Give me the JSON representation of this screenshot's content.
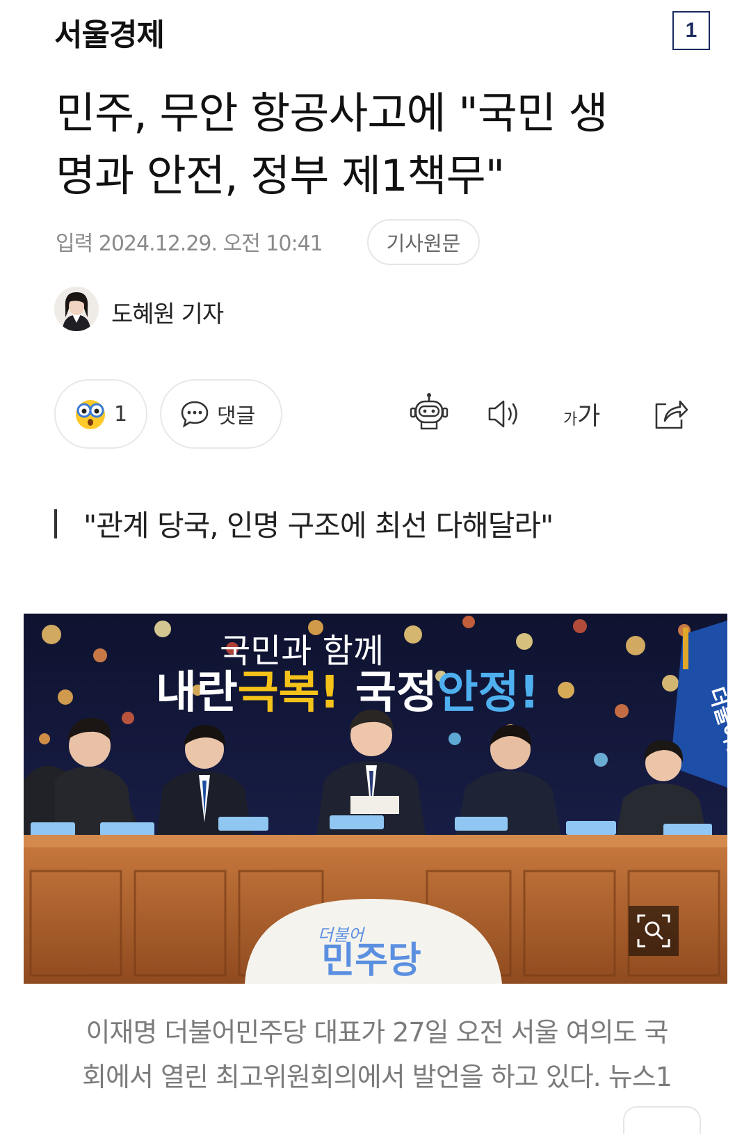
{
  "header": {
    "publisher": "서울경제",
    "page_badge": "1"
  },
  "article": {
    "headline_line1": "민주, 무안 항공사고에 \"국민 생",
    "headline_line2": "명과 안전, 정부 제1책무\"",
    "published": "입력 2024.12.29. 오전 10:41",
    "original_button": "기사원문",
    "reporter": "도혜원 기자",
    "reaction_count": "1",
    "comment_label": "댓글",
    "font_size_label_small": "가",
    "font_size_label_large": "가",
    "subheading": "\"관계 당국, 인명 구조에 최선 다해달라\""
  },
  "photo": {
    "banner_line1": "국민과 함께",
    "banner_part1": "내란",
    "banner_part2": "극복!",
    "banner_part3": "국정",
    "banner_part4": "안정!",
    "flag_text": "더불어민주당",
    "podium_small": "더불어",
    "podium_large": "민주당"
  },
  "caption": {
    "line1": "이재명 더불어민주당 대표가 27일 오전 서울 여의도 국",
    "line2": "회에서 열린 최고위원회의에서 발언을 하고 있다. 뉴스1"
  },
  "colors": {
    "banner_yellow": "#f5c21a",
    "banner_blue": "#4fb0f0",
    "party_blue": "#1d4fa8",
    "podium_blue": "#5b8fe0"
  },
  "icons": [
    "surprised-emoji-icon",
    "comment-bubble-icon",
    "robot-summary-icon",
    "speaker-icon",
    "font-size-icon",
    "share-icon",
    "zoom-icon"
  ]
}
